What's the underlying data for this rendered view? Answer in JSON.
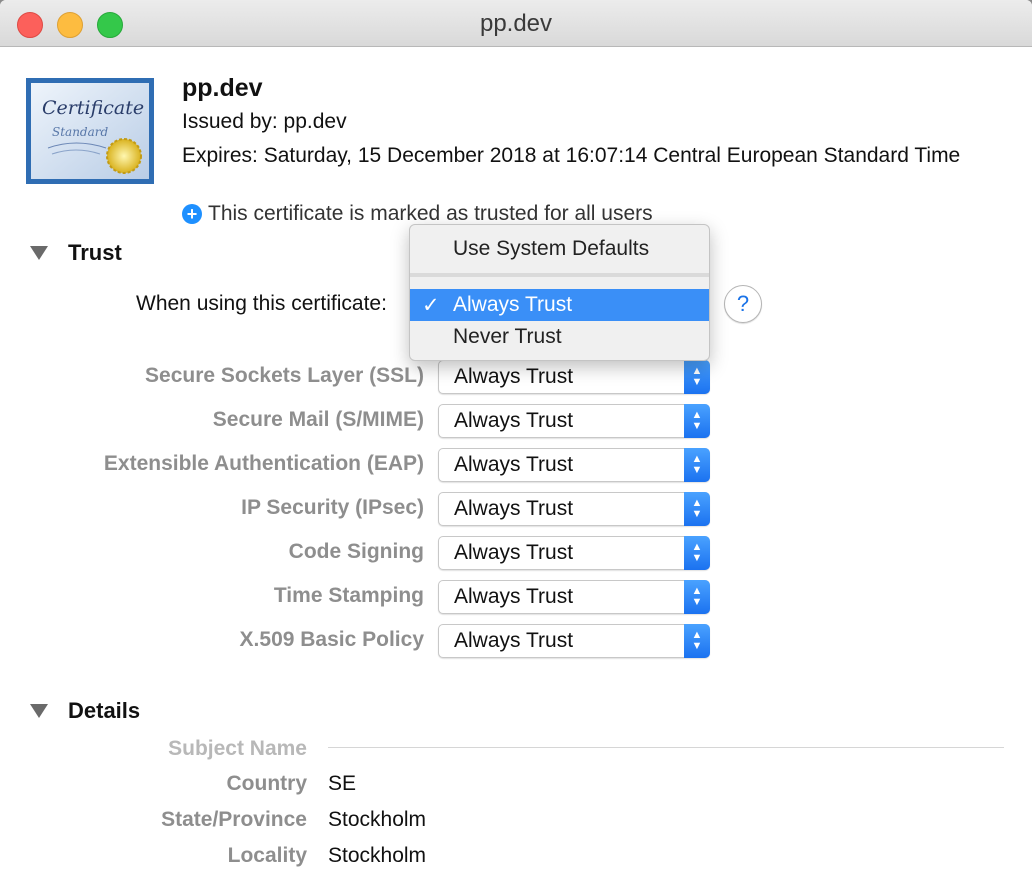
{
  "window": {
    "title": "pp.dev"
  },
  "header": {
    "icon_text": [
      "Certificate",
      "Standard"
    ],
    "name": "pp.dev",
    "issued_by": "Issued by: pp.dev",
    "expires": "Expires: Saturday, 15 December 2018 at 16:07:14 Central European Standard Time",
    "trusted_note": "This certificate is marked as trusted for all users"
  },
  "trust": {
    "section_title": "Trust",
    "when_label": "When using this certificate:",
    "menu": {
      "items": [
        {
          "label": "Use System Defaults",
          "selected": false
        },
        {
          "label": "Always Trust",
          "selected": true
        },
        {
          "label": "Never Trust",
          "selected": false
        }
      ]
    },
    "rows": [
      {
        "label": "Secure Sockets Layer (SSL)",
        "value": "Always Trust"
      },
      {
        "label": "Secure Mail (S/MIME)",
        "value": "Always Trust"
      },
      {
        "label": "Extensible Authentication (EAP)",
        "value": "Always Trust"
      },
      {
        "label": "IP Security (IPsec)",
        "value": "Always Trust"
      },
      {
        "label": "Code Signing",
        "value": "Always Trust"
      },
      {
        "label": "Time Stamping",
        "value": "Always Trust"
      },
      {
        "label": "X.509 Basic Policy",
        "value": "Always Trust"
      }
    ]
  },
  "details": {
    "section_title": "Details",
    "subject_header": "Subject Name",
    "fields": [
      {
        "label": "Country",
        "value": "SE"
      },
      {
        "label": "State/Province",
        "value": "Stockholm"
      },
      {
        "label": "Locality",
        "value": "Stockholm"
      }
    ]
  },
  "colors": {
    "accent": "#3a8ff7",
    "label_gray": "#8e8e8e"
  },
  "icons": {
    "help": "?",
    "check": "✓",
    "plus": "+"
  }
}
